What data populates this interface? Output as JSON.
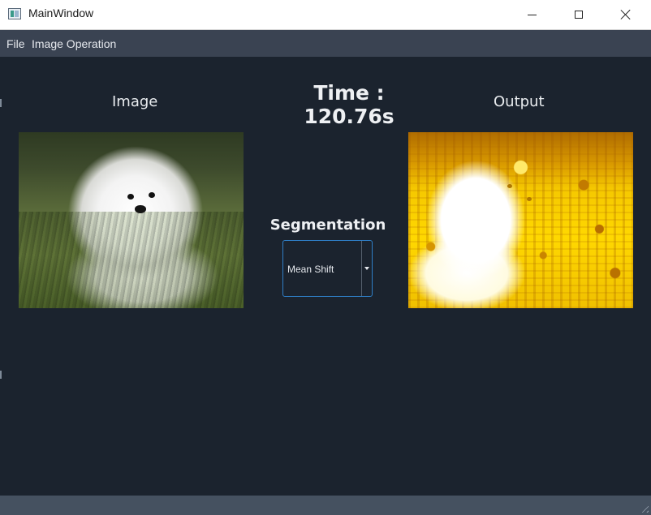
{
  "window": {
    "title": "MainWindow"
  },
  "menubar": {
    "items": [
      "File",
      "Image Operation"
    ]
  },
  "main": {
    "image_label": "Image",
    "output_label": "Output",
    "time_label": "Time : 120.76s",
    "segmentation_label": "Segmentation",
    "segmentation_combo": {
      "selected": "Mean Shift"
    }
  },
  "colors": {
    "titlebar": "#ffffff",
    "menubar": "#3a4352",
    "central": "#1b232e",
    "statusbar": "#455160",
    "accent": "#2f7fc7"
  },
  "icons": {
    "app": "app-window-icon",
    "minimize": "minimize-icon",
    "maximize": "maximize-icon",
    "close": "close-icon",
    "combo_arrow": "chevron-down-icon",
    "size_grip": "size-grip-icon"
  }
}
